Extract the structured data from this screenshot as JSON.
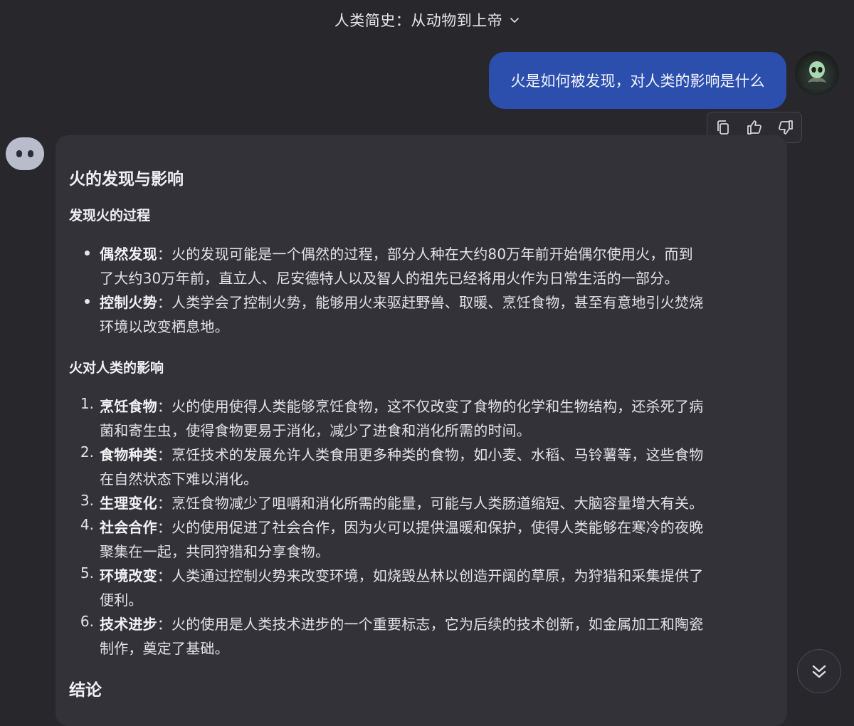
{
  "header": {
    "title": "人类简史：从动物到上帝"
  },
  "user_message": {
    "text": "火是如何被发现，对人类的影响是什么"
  },
  "answer": {
    "title": "火的发现与影响",
    "section1_heading": "发现火的过程",
    "bullets": [
      {
        "term": "偶然发现",
        "line1": "：火的发现可能是一个偶然的过程，部分人种在大约80万年前开始偶尔使用火，而到",
        "line2": "了大约30万年前，直立人、尼安德特人以及智人的祖先已经将用火作为日常生活的一部分。"
      },
      {
        "term": "控制火势",
        "line1": "：人类学会了控制火势，能够用火来驱赶野兽、取暖、烹饪食物，甚至有意地引火焚烧",
        "line2": "环境以改变栖息地。"
      }
    ],
    "section2_heading": "火对人类的影响",
    "items": [
      {
        "num": "1.",
        "term": "烹饪食物",
        "line1": "：火的使用使得人类能够烹饪食物，这不仅改变了食物的化学和生物结构，还杀死了病",
        "line2": "菌和寄生虫，使得食物更易于消化，减少了进食和消化所需的时间。"
      },
      {
        "num": "2.",
        "term": "食物种类",
        "line1": "：烹饪技术的发展允许人类食用更多种类的食物，如小麦、水稻、马铃薯等，这些食物",
        "line2": "在自然状态下难以消化。"
      },
      {
        "num": "3.",
        "term": "生理变化",
        "line1": "：烹饪食物减少了咀嚼和消化所需的能量，可能与人类肠道缩短、大脑容量增大有关。",
        "line2": ""
      },
      {
        "num": "4.",
        "term": "社会合作",
        "line1": "：火的使用促进了社会合作，因为火可以提供温暖和保护，使得人类能够在寒冷的夜晚",
        "line2": "聚集在一起，共同狩猎和分享食物。"
      },
      {
        "num": "5.",
        "term": "环境改变",
        "line1": "：人类通过控制火势来改变环境，如烧毁丛林以创造开阔的草原，为狩猎和采集提供了",
        "line2": "便利。"
      },
      {
        "num": "6.",
        "term": "技术进步",
        "line1": "：火的使用是人类技术进步的一个重要标志，它为后续的技术创新，如金属加工和陶瓷",
        "line2": "制作，奠定了基础。"
      }
    ],
    "conclusion_heading": "结论"
  },
  "icons": {
    "header_chevron": "chevron-down-icon",
    "copy": "copy-icon",
    "thumbs_up": "thumbs-up-icon",
    "thumbs_down": "thumbs-down-icon",
    "scroll_down": "double-chevron-down-icon"
  },
  "colors": {
    "background": "#27272c",
    "user_bubble": "#2c4fad",
    "answer_card": "#323238"
  }
}
